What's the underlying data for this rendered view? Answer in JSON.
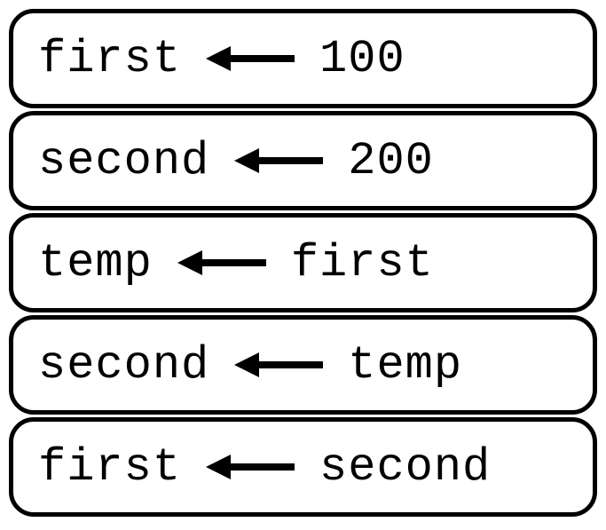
{
  "blocks": [
    {
      "left": "first",
      "right": "100"
    },
    {
      "left": "second",
      "right": "200"
    },
    {
      "left": "temp",
      "right": "first"
    },
    {
      "left": "second",
      "right": "temp"
    },
    {
      "left": "first",
      "right": "second"
    }
  ]
}
